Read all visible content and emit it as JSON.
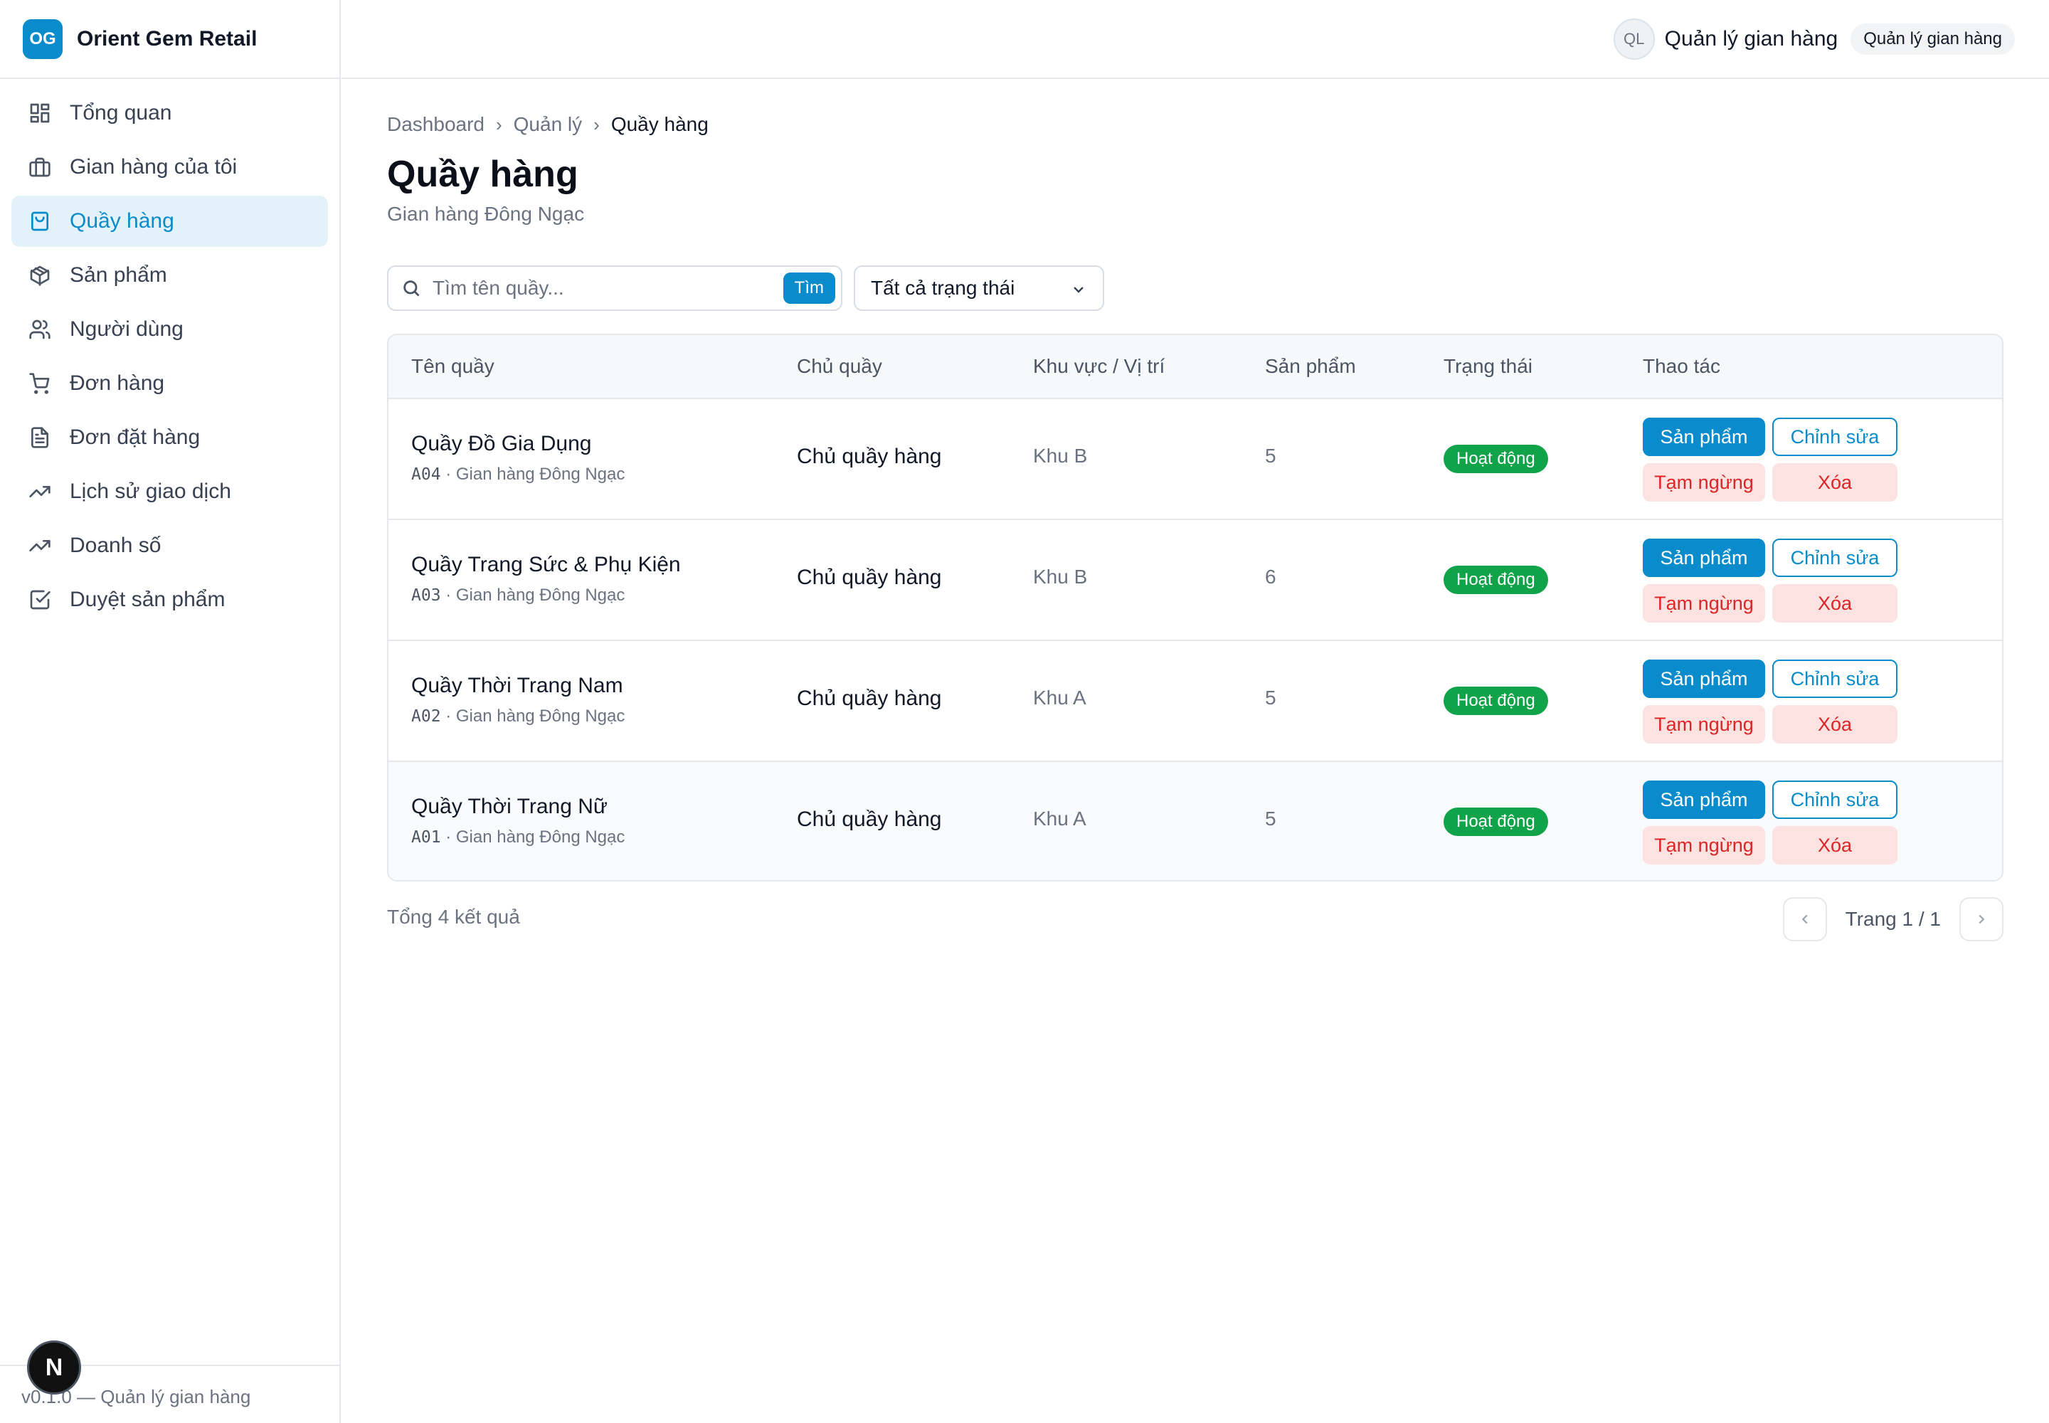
{
  "brand": {
    "logo": "OG",
    "name": "Orient Gem Retail"
  },
  "sidebar": {
    "items": [
      {
        "label": "Tổng quan",
        "icon": "dashboard-icon",
        "active": false
      },
      {
        "label": "Gian hàng của tôi",
        "icon": "briefcase-icon",
        "active": false
      },
      {
        "label": "Quầy hàng",
        "icon": "shopping-bag-icon",
        "active": true
      },
      {
        "label": "Sản phẩm",
        "icon": "package-icon",
        "active": false
      },
      {
        "label": "Người dùng",
        "icon": "users-icon",
        "active": false
      },
      {
        "label": "Đơn hàng",
        "icon": "cart-icon",
        "active": false
      },
      {
        "label": "Đơn đặt hàng",
        "icon": "document-icon",
        "active": false
      },
      {
        "label": "Lịch sử giao dịch",
        "icon": "trending-up-icon",
        "active": false
      },
      {
        "label": "Doanh số",
        "icon": "trending-up-icon",
        "active": false
      },
      {
        "label": "Duyệt sản phẩm",
        "icon": "check-square-icon",
        "active": false
      }
    ],
    "footer": "v0.1.0 — Quản lý gian hàng",
    "next_badge": "N"
  },
  "topbar": {
    "avatar": "QL",
    "user_name": "Quản lý gian hàng",
    "role": "Quản lý gian hàng"
  },
  "breadcrumb": {
    "items": [
      "Dashboard",
      "Quản lý"
    ],
    "current": "Quầy hàng"
  },
  "page": {
    "title": "Quầy hàng",
    "subtitle": "Gian hàng Đông Ngạc"
  },
  "filters": {
    "search_placeholder": "Tìm tên quầy...",
    "search_button": "Tìm",
    "status_selected": "Tất cả trạng thái"
  },
  "table": {
    "headers": {
      "name": "Tên quầy",
      "owner": "Chủ quầy",
      "area": "Khu vực / Vị trí",
      "products": "Sản phẩm",
      "status": "Trạng thái",
      "actions": "Thao tác"
    },
    "actions": {
      "products": "Sản phẩm",
      "edit": "Chỉnh sửa",
      "suspend": "Tạm ngừng",
      "delete": "Xóa"
    },
    "rows": [
      {
        "name": "Quầy Đồ Gia Dụng",
        "code": "A04",
        "store": "· Gian hàng Đông Ngạc",
        "owner": "Chủ quầy hàng",
        "area": "Khu B",
        "products": "5",
        "status": "Hoạt động"
      },
      {
        "name": "Quầy Trang Sức & Phụ Kiện",
        "code": "A03",
        "store": "· Gian hàng Đông Ngạc",
        "owner": "Chủ quầy hàng",
        "area": "Khu B",
        "products": "6",
        "status": "Hoạt động"
      },
      {
        "name": "Quầy Thời Trang Nam",
        "code": "A02",
        "store": "· Gian hàng Đông Ngạc",
        "owner": "Chủ quầy hàng",
        "area": "Khu A",
        "products": "5",
        "status": "Hoạt động"
      },
      {
        "name": "Quầy Thời Trang Nữ",
        "code": "A01",
        "store": "· Gian hàng Đông Ngạc",
        "owner": "Chủ quầy hàng",
        "area": "Khu A",
        "products": "5",
        "status": "Hoạt động"
      }
    ]
  },
  "footer": {
    "total": "Tổng 4 kết quả",
    "page_info": "Trang 1 / 1"
  },
  "colors": {
    "primary": "#0a8bcb",
    "success": "#10a34a",
    "danger": "#dc2626",
    "danger_bg": "#fde2e2",
    "active_bg": "#e3f2f9"
  }
}
